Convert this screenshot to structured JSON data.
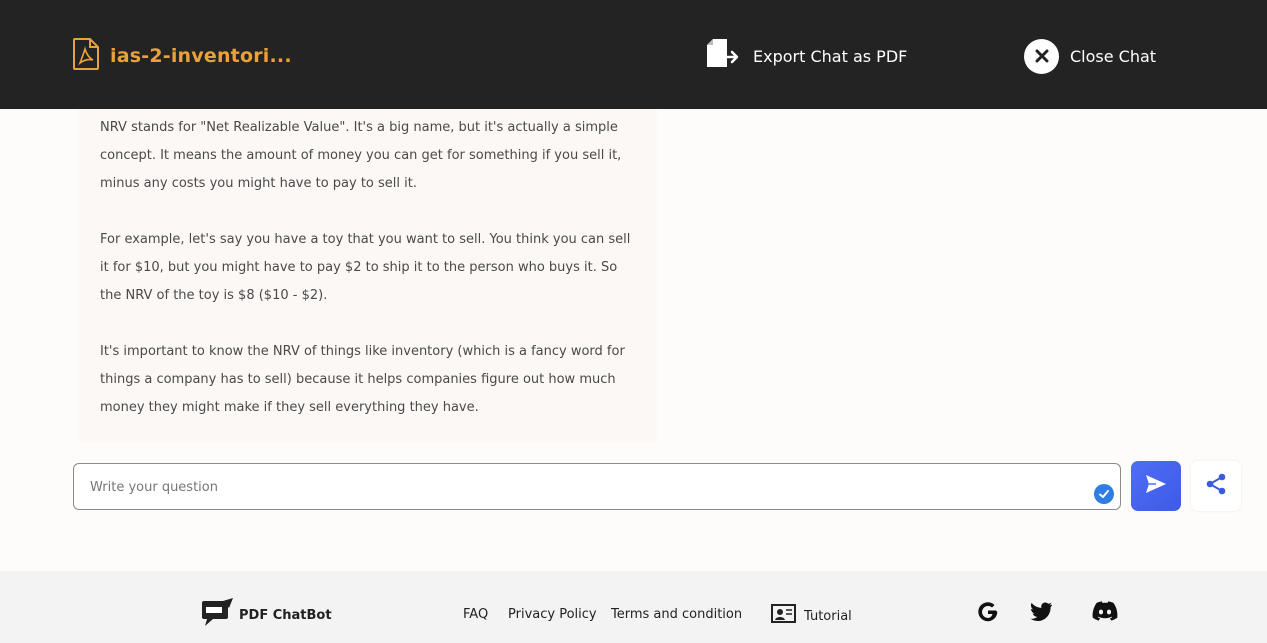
{
  "header": {
    "document_title": "ias-2-inventori...",
    "export_label": "Export Chat as PDF",
    "close_label": "Close Chat"
  },
  "chat": {
    "message_paragraphs": [
      "NRV stands for \"Net Realizable Value\". It's a big name, but it's actually a simple concept. It means the amount of money you can get for something if you sell it, minus any costs you might have to pay to sell it.",
      "For example, let's say you have a toy that you want to sell. You think you can sell it for $10, but you might have to pay $2 to ship it to the person who buys it. So the NRV of the toy is $8 ($10 - $2).",
      "It's important to know the NRV of things like inventory (which is a fancy word for things a company has to sell) because it helps companies figure out how much money they might make if they sell everything they have."
    ]
  },
  "input": {
    "placeholder": "Write your question",
    "value": ""
  },
  "footer": {
    "brand_name": "PDF ChatBot",
    "links": {
      "faq": "FAQ",
      "privacy": "Privacy Policy",
      "terms": "Terms and condition",
      "tutorial": "Tutorial"
    },
    "social_icons": [
      "google-icon",
      "twitter-icon",
      "discord-icon"
    ]
  },
  "colors": {
    "header_bg": "#232323",
    "doc_title": "#e9a23b",
    "send_button": "#4f6df5",
    "share_icon": "#3b5bdb",
    "check_badge": "#2f7de1"
  }
}
